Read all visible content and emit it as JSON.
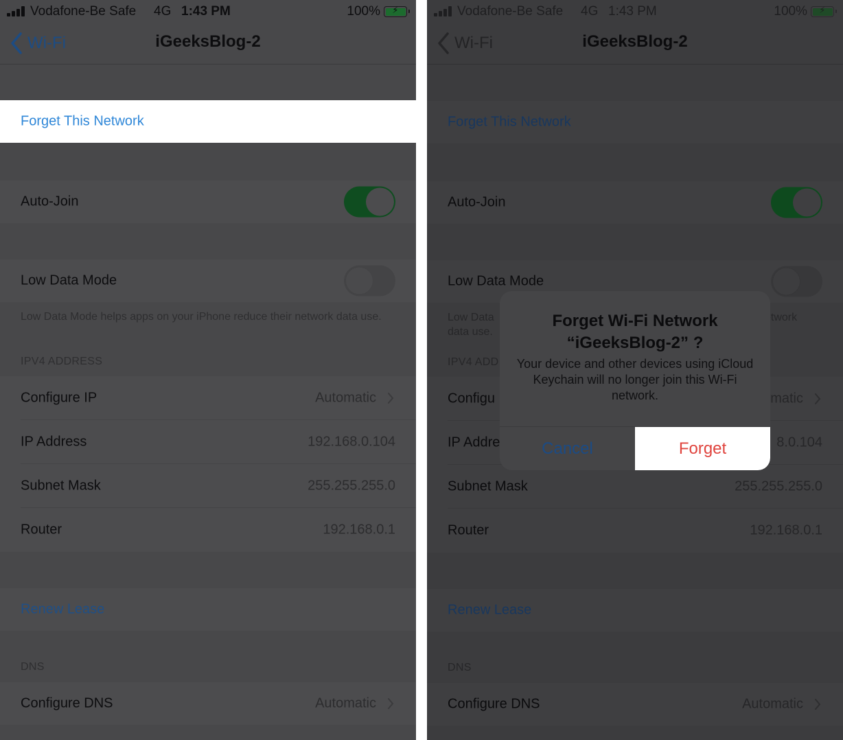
{
  "status_bar": {
    "carrier": "Vodafone-Be Safe",
    "network": "4G",
    "time": "1:43 PM",
    "battery_percent": "100%",
    "battery_level": 1.0,
    "battery_charging": true,
    "signal_bars": 4,
    "signal_icon": "cellular-signal-icon",
    "battery_icon": "battery-charging-icon",
    "bolt_glyph": "⚡"
  },
  "nav": {
    "back_label": "Wi-Fi",
    "back_icon": "chevron-left-icon",
    "title": "iGeeksBlog-2"
  },
  "settings": {
    "forget_network": "Forget This Network",
    "auto_join": {
      "label": "Auto-Join",
      "value": true
    },
    "low_data_mode": {
      "label": "Low Data Mode",
      "value": false
    },
    "low_data_footer": "Low Data Mode helps apps on your iPhone reduce their network data use.",
    "low_data_footer_partial_left": "Low Data",
    "low_data_footer_partial_left2": "data use.",
    "low_data_footer_partial_right": "etwork",
    "ipv4_header": "IPV4 ADDRESS",
    "ipv4_header_partial": "IPV4 ADD",
    "ipv4_rows": [
      {
        "label": "Configure IP",
        "value": "Automatic",
        "chevron": true,
        "partial_label": "Configu",
        "partial_value": "matic"
      },
      {
        "label": "IP Address",
        "value": "192.168.0.104",
        "chevron": false,
        "partial_label": "IP Addre",
        "partial_value": "8.0.104"
      },
      {
        "label": "Subnet Mask",
        "value": "255.255.255.0",
        "chevron": false
      },
      {
        "label": "Router",
        "value": "192.168.0.1",
        "chevron": false
      }
    ],
    "renew_lease": "Renew Lease",
    "dns_header": "DNS",
    "configure_dns": {
      "label": "Configure DNS",
      "value": "Automatic"
    }
  },
  "alert": {
    "title_line1": "Forget Wi-Fi Network",
    "title_line2": "“iGeeksBlog-2” ?",
    "message": "Your device and other devices using iCloud Keychain will no longer join this Wi-Fi network.",
    "cancel_label": "Cancel",
    "forget_label": "Forget"
  },
  "colors": {
    "ios_blue": "#2f87d8",
    "destructive_red": "#e0443e",
    "toggle_on_green": "#0f5222",
    "highlight_white": "#ffffff"
  }
}
